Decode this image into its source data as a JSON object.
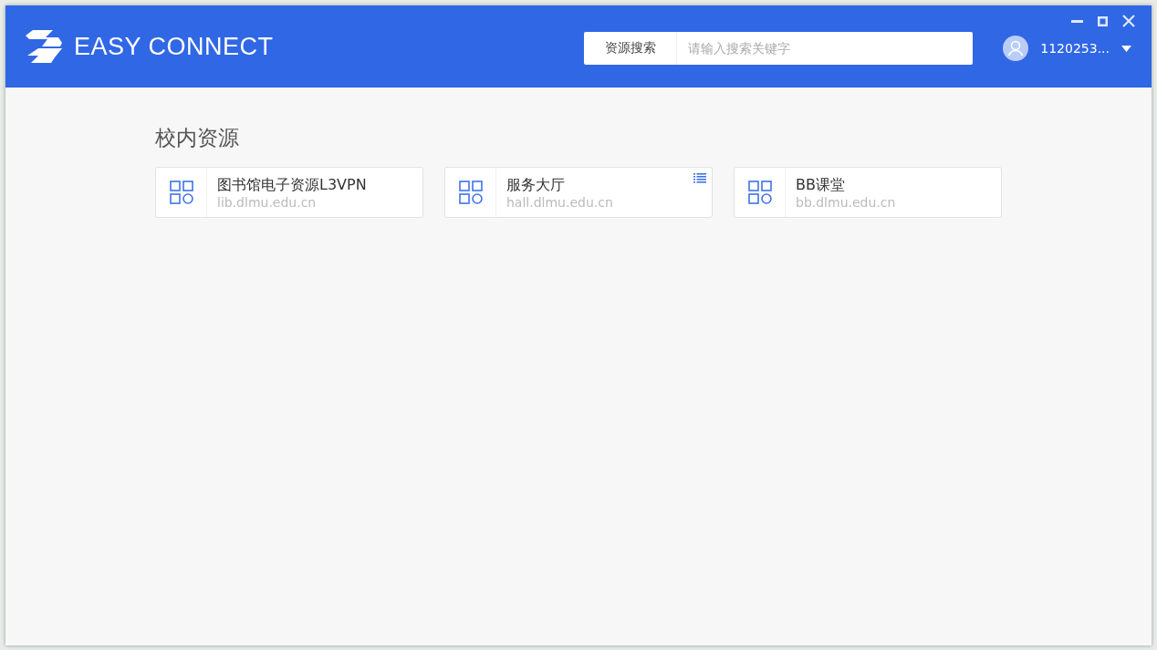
{
  "header": {
    "logo_text": "EASY CONNECT",
    "search": {
      "button": "资源搜索",
      "placeholder": "请输入搜索关键字"
    },
    "user": {
      "name": "1120253..."
    }
  },
  "section": {
    "title": "校内资源",
    "resources": [
      {
        "name": "图书馆电子资源L3VPN",
        "address": "lib.dlmu.edu.cn",
        "menu": false
      },
      {
        "name": "服务大厅",
        "address": "hall.dlmu.edu.cn",
        "menu": true
      },
      {
        "name": "BB课堂",
        "address": "bb.dlmu.edu.cn",
        "menu": false
      }
    ]
  }
}
